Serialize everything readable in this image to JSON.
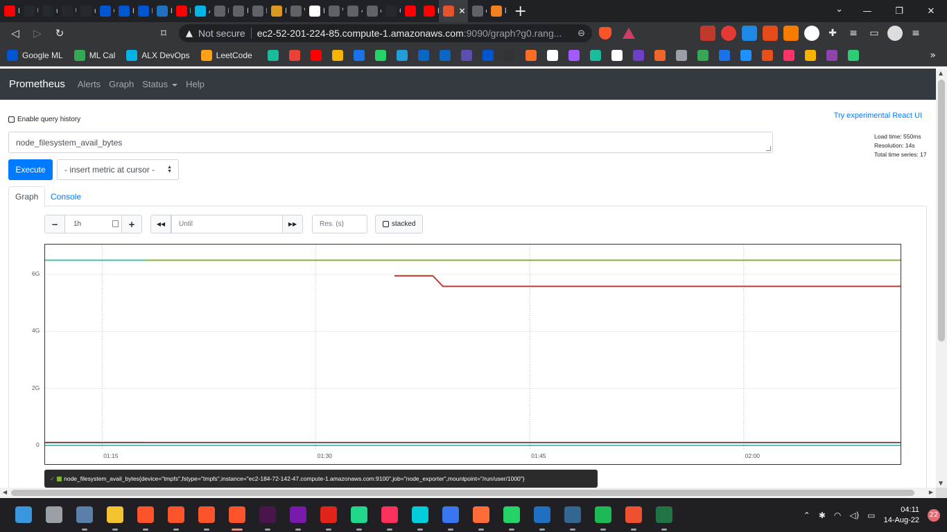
{
  "browser": {
    "tabs": [
      {
        "title": "H",
        "icon": "youtube-icon",
        "color": "#ff0000"
      },
      {
        "title": "Us",
        "icon": "github-icon",
        "color": "#24292e"
      },
      {
        "title": "uc",
        "icon": "github-icon",
        "color": "#24292e"
      },
      {
        "title": "U",
        "icon": "github-icon",
        "color": "#24292e"
      },
      {
        "title": "uc",
        "icon": "github-icon",
        "color": "#24292e"
      },
      {
        "title": "G",
        "icon": "coursera-icon",
        "color": "#0056d2"
      },
      {
        "title": "Lc",
        "icon": "coursera-icon",
        "color": "#0056d2"
      },
      {
        "title": "Lc",
        "icon": "coursera-icon",
        "color": "#0056d2"
      },
      {
        "title": "H",
        "icon": "ibm-icon",
        "color": "#1f70c1"
      },
      {
        "title": "H",
        "icon": "youtube-icon",
        "color": "#ff0000"
      },
      {
        "title": "Al",
        "icon": "udacity-icon",
        "color": "#02b3e4"
      },
      {
        "title": "Pr",
        "icon": "page-icon",
        "color": "#5f6368"
      },
      {
        "title": "In",
        "icon": "page-icon",
        "color": "#5f6368"
      },
      {
        "title": "Pr",
        "icon": "page-icon",
        "color": "#5f6368"
      },
      {
        "title": "In",
        "icon": "package-icon",
        "color": "#d79b22"
      },
      {
        "title": "W",
        "icon": "globe-icon",
        "color": "#5f6368"
      },
      {
        "title": "Pi",
        "icon": "circle-icon",
        "color": "#ffffff"
      },
      {
        "title": "W",
        "icon": "globe-icon",
        "color": "#5f6368"
      },
      {
        "title": "4C",
        "icon": "globe-icon",
        "color": "#5f6368"
      },
      {
        "title": "ec",
        "icon": "globe-icon",
        "color": "#5f6368"
      },
      {
        "title": "Gi",
        "icon": "github-icon",
        "color": "#24292e"
      },
      {
        "title": "",
        "icon": "youtube-icon",
        "color": "#ff0000"
      },
      {
        "title": "Er",
        "icon": "youtube-icon",
        "color": "#ff0000"
      },
      {
        "title": "",
        "icon": "prometheus-icon",
        "color": "#e6522c"
      },
      {
        "title": "ec",
        "icon": "globe-icon",
        "color": "#5f6368"
      },
      {
        "title": "ku",
        "icon": "stackoverflow-icon",
        "color": "#f48024"
      }
    ],
    "active_tab_index": 23,
    "new_tab": "+",
    "address": {
      "security": "Not secure",
      "host": "ec2-52-201-224-85.compute-1.amazonaws.com",
      "path": ":9090/graph?g0.rang..."
    },
    "bookmarks": [
      {
        "label": "Google ML",
        "icon": "coursera-icon",
        "color": "#0056d2"
      },
      {
        "label": "ML Cal",
        "icon": "plus-icon",
        "color": "#34a853"
      },
      {
        "label": "ALX DevOps",
        "icon": "udacity-icon",
        "color": "#02b3e4"
      },
      {
        "label": "LeetCode",
        "icon": "leetcode-icon",
        "color": "#ffa116"
      }
    ],
    "bookmark_icon_colors": [
      "#1abc9c",
      "#ea4335",
      "#ff0000",
      "#f5b400",
      "#1a73e8",
      "#25d366",
      "#229ed9",
      "#0a66c2",
      "#0a66c2",
      "#5c4db1",
      "#0056d2",
      "#333333",
      "#fc6d26",
      "#ffffff",
      "#a259ff",
      "#1abc9c",
      "#ffffff",
      "#6e40c9",
      "#f06529",
      "#9aa0a6",
      "#34a853",
      "#1a73e8",
      "#1e90ff",
      "#e94e1b",
      "#ff3366",
      "#f5b400",
      "#8e44ad",
      "#2ecc71"
    ]
  },
  "navbar": {
    "brand": "Prometheus",
    "links": [
      "Alerts",
      "Graph",
      "Status",
      "Help"
    ]
  },
  "page": {
    "query_history_label": "Enable query history",
    "react_link": "Try experimental React UI",
    "stats": {
      "load_time": "Load time: 550ms",
      "resolution": "Resolution: 14s",
      "total_series": "Total time series: 17"
    },
    "expression": "node_filesystem_avail_bytes",
    "execute_label": "Execute",
    "metric_select": "- insert metric at cursor -",
    "tabs": [
      "Graph",
      "Console"
    ],
    "controls": {
      "minus": "−",
      "range_value": "1h",
      "plus": "+",
      "back": "◀◀",
      "until_placeholder": "Until",
      "forward": "▶▶",
      "res_placeholder": "Res. (s)",
      "stacked": "stacked"
    },
    "legend_text": "node_filesystem_avail_bytes{device=\"tmpfs\",fstype=\"tmpfs\",instance=\"ec2-184-72-142-47.compute-1.amazonaws.com:9100\",job=\"node_exporter\",mountpoint=\"/run/user/1000\"}"
  },
  "chart_data": {
    "type": "line",
    "y_ticks": [
      "0",
      "2G",
      "4G",
      "6G"
    ],
    "y_tick_values": [
      0,
      2000000000,
      4000000000,
      6000000000
    ],
    "x_ticks": [
      "01:15",
      "01:30",
      "01:45",
      "02:00"
    ],
    "x_tick_minutes": [
      75,
      90,
      105,
      120
    ],
    "xlim_minutes": [
      71,
      131
    ],
    "ylim": [
      0,
      7000000000
    ],
    "grid": true,
    "series": [
      {
        "color": "#7fb53d",
        "x": [
          71,
          131
        ],
        "y": [
          6500000000,
          6500000000
        ]
      },
      {
        "color": "#5bbfbf",
        "x": [
          71,
          78
        ],
        "y": [
          6500000000,
          6500000000
        ]
      },
      {
        "color": "#c0392b",
        "x": [
          95.5,
          98.2,
          98.9,
          131
        ],
        "y": [
          5950000000,
          5950000000,
          5580000000,
          5580000000
        ]
      },
      {
        "color": "#7fb53d",
        "x": [
          71,
          78
        ],
        "y": [
          100000000,
          100000000
        ]
      },
      {
        "color": "#6b4f4f",
        "x": [
          71,
          131
        ],
        "y": [
          100000000,
          100000000
        ]
      },
      {
        "color": "#5bbfbf",
        "x": [
          71,
          131
        ],
        "y": [
          0,
          0
        ]
      }
    ]
  },
  "taskbar": {
    "clock_time": "04:11",
    "clock_date": "14-Aug-22",
    "notifications": "22",
    "apps": [
      {
        "name": "windows-start-icon",
        "color": "#3a96dd"
      },
      {
        "name": "task-view-icon",
        "color": "#9aa0a6"
      },
      {
        "name": "photos-icon",
        "color": "#5b7fa8"
      },
      {
        "name": "file-explorer-icon",
        "color": "#f4c430"
      },
      {
        "name": "brave-icon",
        "color": "#fb542b"
      },
      {
        "name": "brave-beta-icon",
        "color": "#fb542b"
      },
      {
        "name": "brave-nightly-icon",
        "color": "#fb542b"
      },
      {
        "name": "brave-active-icon",
        "color": "#fb542b"
      },
      {
        "name": "slack-icon",
        "color": "#4a154b"
      },
      {
        "name": "onenote-icon",
        "color": "#7719aa"
      },
      {
        "name": "acrobat-icon",
        "color": "#e2231a"
      },
      {
        "name": "pycharm-icon",
        "color": "#21d789"
      },
      {
        "name": "intellij-icon",
        "color": "#fe315d"
      },
      {
        "name": "webstorm-icon",
        "color": "#00cdd7"
      },
      {
        "name": "signal-icon",
        "color": "#3a76f0"
      },
      {
        "name": "postman-icon",
        "color": "#ff6c37"
      },
      {
        "name": "whatsapp-icon",
        "color": "#25d366"
      },
      {
        "name": "remote-desktop-icon",
        "color": "#1f70c1"
      },
      {
        "name": "postgres-icon",
        "color": "#336791"
      },
      {
        "name": "spotify-icon",
        "color": "#1db954"
      },
      {
        "name": "git-icon",
        "color": "#f05032"
      },
      {
        "name": "excel-icon",
        "color": "#217346"
      }
    ]
  }
}
